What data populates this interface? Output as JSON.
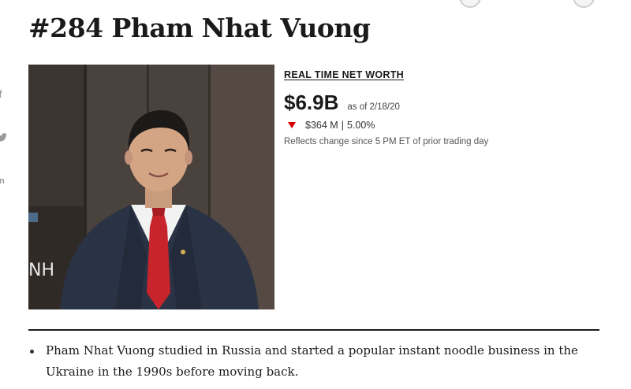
{
  "profile": {
    "title": "#284 Pham Nhat Vuong",
    "photo_alt": "Pham Nhat Vuong"
  },
  "social": {
    "items": [
      {
        "icon": "facebook-icon",
        "glyph": "f"
      },
      {
        "icon": "twitter-icon",
        "glyph": "❤"
      },
      {
        "icon": "linkedin-icon",
        "glyph": "in"
      }
    ]
  },
  "networth": {
    "label": "REAL TIME NET WORTH",
    "value": "$6.9B",
    "as_of": "as of 2/18/20",
    "change_amount": "$364 M",
    "change_separator": "|",
    "change_percent": "5.00%",
    "direction": "down",
    "direction_color": "#d40000",
    "note": "Reflects change since 5 PM ET of prior trading day"
  },
  "bio": {
    "bullets": [
      "Pham Nhat Vuong studied in Russia and started a popular instant noodle business in the Ukraine in the 1990s before moving back."
    ]
  }
}
